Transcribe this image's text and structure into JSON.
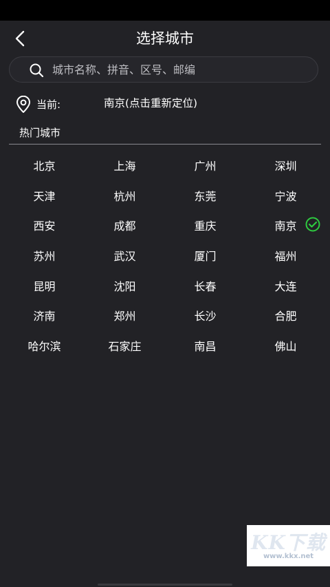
{
  "header": {
    "title": "选择城市",
    "back_icon": "chevron-left-icon"
  },
  "search": {
    "placeholder": "城市名称、拼音、区号、邮编",
    "value": "",
    "icon": "search-icon"
  },
  "current": {
    "label": "当前:",
    "value": "南京(点击重新定位)",
    "icon": "location-pin-icon"
  },
  "hot": {
    "title": "热门城市",
    "selected": "南京",
    "cities": [
      "北京",
      "上海",
      "广州",
      "深圳",
      "天津",
      "杭州",
      "东莞",
      "宁波",
      "西安",
      "成都",
      "重庆",
      "南京",
      "苏州",
      "武汉",
      "厦门",
      "福州",
      "昆明",
      "沈阳",
      "长春",
      "大连",
      "济南",
      "郑州",
      "长沙",
      "合肥",
      "哈尔滨",
      "石家庄",
      "南昌",
      "佛山"
    ]
  },
  "watermark": {
    "logo": "KK下载",
    "url": "www.kkx.net"
  },
  "colors": {
    "background": "#222226",
    "text": "#ffffff",
    "accent_check": "#2ecc40",
    "divider": "#8a8a8f"
  }
}
